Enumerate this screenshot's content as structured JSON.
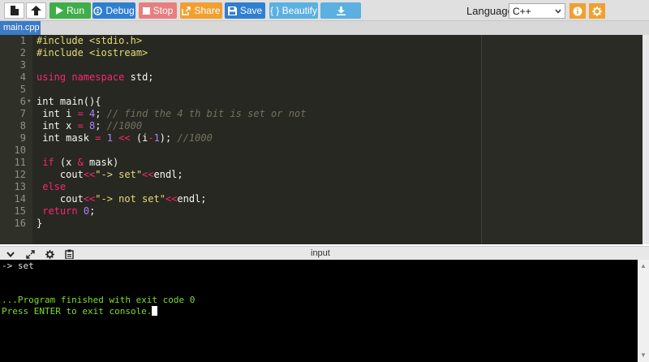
{
  "toolbar": {
    "run_label": "Run",
    "debug_label": "Debug",
    "stop_label": "Stop",
    "share_label": "Share",
    "save_label": "Save",
    "beautify_label": "{ } Beautify",
    "language_label": "Language",
    "language_value": "C++",
    "colors": {
      "run": "#3fae49",
      "debug": "#2f7fd0",
      "stop": "#e87f7f",
      "share": "#f0a030",
      "save": "#2f7fd0",
      "beautify": "#5ab0e0",
      "download": "#5ab0e0"
    }
  },
  "tabs": [
    {
      "label": "main.cpp"
    }
  ],
  "editor": {
    "lines": [
      {
        "n": "1",
        "text": "#include <stdio.h>"
      },
      {
        "n": "2",
        "text": "#include <iostream>"
      },
      {
        "n": "3",
        "text": ""
      },
      {
        "n": "4",
        "text": "using namespace std;"
      },
      {
        "n": "5",
        "text": ""
      },
      {
        "n": "6",
        "text": "int main(){"
      },
      {
        "n": "7",
        "text": " int i = 4; // find the 4 th bit is set or not"
      },
      {
        "n": "8",
        "text": " int x = 8; //1000"
      },
      {
        "n": "9",
        "text": " int mask = 1 << (i-1); //1000"
      },
      {
        "n": "10",
        "text": ""
      },
      {
        "n": "11",
        "text": " if (x & mask)"
      },
      {
        "n": "12",
        "text": "    cout<<\"-> set\"<<endl;"
      },
      {
        "n": "13",
        "text": " else"
      },
      {
        "n": "14",
        "text": "    cout<<\"-> not set\"<<endl;"
      },
      {
        "n": "15",
        "text": " return 0;"
      },
      {
        "n": "16",
        "text": "}"
      }
    ]
  },
  "console": {
    "title": "input",
    "output_line1": "-> set",
    "finished_line": "...Program finished with exit code 0",
    "prompt_line": "Press ENTER to exit console."
  }
}
